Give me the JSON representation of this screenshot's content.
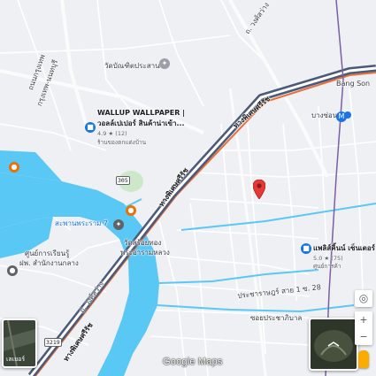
{
  "app": {
    "logo_text": "Google Maps"
  },
  "colors": {
    "land": "#eef0f3",
    "water": "#5ac8f5",
    "water_dark": "#3aa9df",
    "expressway_casing": "#4a5a78",
    "expressway_fill": "#ffffff",
    "orange_line": "#e8703a",
    "park": "#cde8c9",
    "pin": "#e53935",
    "poi_blue": "#1a73e8",
    "poi_orange": "#e8710a"
  },
  "labels": {
    "road_top_center": "ถ. วงศ์สว่าง",
    "road_top_left_1": "ถนนกรุงเทพ",
    "road_top_left_2": "กรุงเทพ-นนทบุรี",
    "temple": "วัดบัณฑิตประสาน",
    "expressway_upper": "ทางพิเศษศรีรัช",
    "expressway_mid": "ทางพิเศษศรีรัช",
    "expressway_lower": "ทางพิเศษศรีรัช",
    "station_bang_son": "บางซ่อน",
    "bridge": "สะพานพระราม 7",
    "temple_river": "วัดสร้อยทอง",
    "temple_river_2": "พระอารามหลวง",
    "road_prachrat": "ประชาราษฎร์ สาย 1 ซ. 28",
    "soi_prachrat": "ซอยประชาภิบาล",
    "road_bottom_left": "ถ. วงศ์สว่าง",
    "district_office": "ศูนย์การเรียนรู้",
    "district_office_2": "ฝพ. สำนักงานกลาง",
    "route_top_right": "Bang Son",
    "shield_1": "305",
    "shield_2": "3219"
  },
  "pois": {
    "wallup_name": "WALLUP WALLPAPER |",
    "wallup_name_2": "วอลล์เปเปอร์ สินค้าน่าเข้า...",
    "wallup_rating": "4.9 ★ (12)",
    "wallup_category": "ร้านของตกแต่งบ้าน",
    "shop_right_name": "แพลิส์คิ้นน์ เซ็นเตอร์",
    "shop_right_rating": "5.0 ★ (75)",
    "shop_right_category": "ศูนย์การค้า"
  },
  "controls": {
    "my_location_icon": "◎",
    "zoom_in": "+",
    "zoom_out": "−",
    "layers_label": "เลเยอร์",
    "pegman_icon": "pegman"
  }
}
